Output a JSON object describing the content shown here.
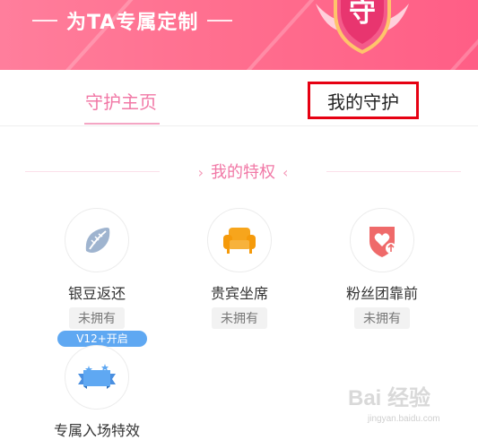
{
  "banner": {
    "title": "为TA专属定制",
    "badge_char": "守"
  },
  "tabs": [
    {
      "label": "守护主页",
      "active": true
    },
    {
      "label": "我的守护",
      "active": false,
      "highlighted": true
    }
  ],
  "section": {
    "title": "我的特权",
    "left_glyph": "›",
    "right_glyph": "‹"
  },
  "privileges": [
    {
      "label": "银豆返还",
      "status": "未拥有",
      "icon": "silver-bean-icon"
    },
    {
      "label": "贵宾坐席",
      "status": "未拥有",
      "icon": "sofa-icon"
    },
    {
      "label": "粉丝团靠前",
      "status": "未拥有",
      "icon": "heart-shield-icon"
    },
    {
      "label": "专属入场特效",
      "status": "",
      "icon": "entrance-banner-icon",
      "tag": "V12+开启"
    }
  ],
  "watermark": {
    "brand": "Bai 经验",
    "url": "jingyan.baidu.com"
  },
  "colors": {
    "banner_pink": "#ff6f8f",
    "accent_pink": "#f178a6",
    "highlight_red": "#e60012",
    "vip_blue": "#5fa8f2",
    "sofa_orange": "#f7a51c",
    "shield_red": "#ef6a6a"
  }
}
